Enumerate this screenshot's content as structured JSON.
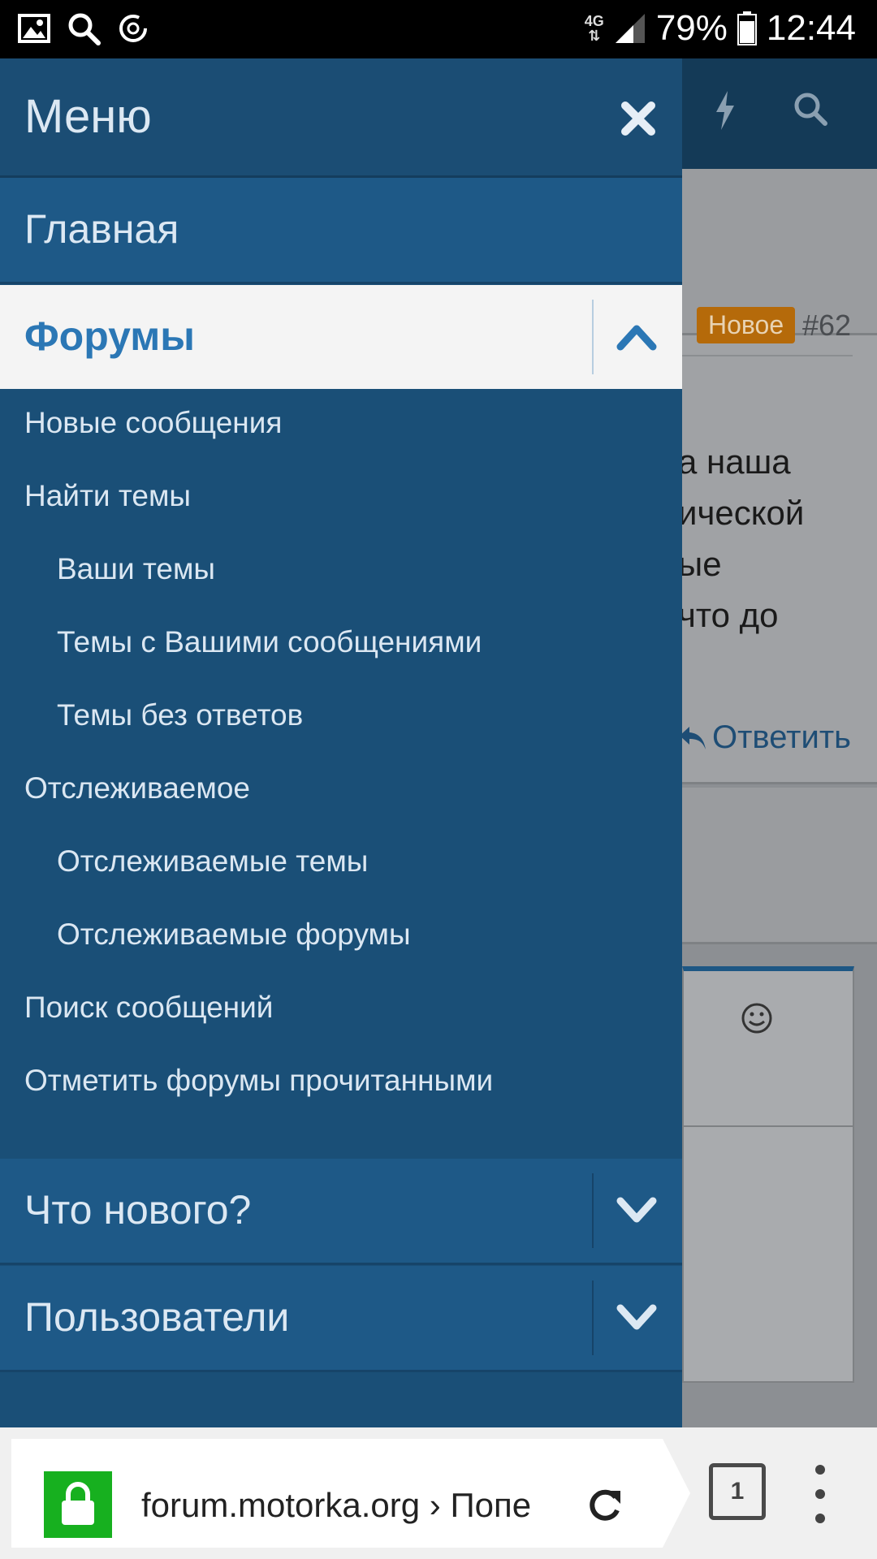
{
  "status_bar": {
    "network": "4G",
    "battery": "79%",
    "time": "12:44",
    "icons": [
      "image-icon",
      "search-icon",
      "sync-icon",
      "signal-icon",
      "battery-icon"
    ]
  },
  "background_page": {
    "badge": "Новое",
    "post_number": "#62",
    "text_lines": [
      "а наша",
      "ической",
      "ые",
      "что до"
    ],
    "reply_label": "Ответить"
  },
  "drawer": {
    "title": "Меню",
    "main_item": "Главная",
    "active_item": "Форумы",
    "forum_sub_items": [
      {
        "label": "Новые сообщения",
        "level": 1
      },
      {
        "label": "Найти темы",
        "level": 1
      },
      {
        "label": "Ваши темы",
        "level": 2
      },
      {
        "label": "Темы с Вашими сообщениями",
        "level": 2
      },
      {
        "label": "Темы без ответов",
        "level": 2
      },
      {
        "label": "Отслеживаемое",
        "level": 1
      },
      {
        "label": "Отслеживаемые темы",
        "level": 2
      },
      {
        "label": "Отслеживаемые форумы",
        "level": 2
      },
      {
        "label": "Поиск сообщений",
        "level": 1
      },
      {
        "label": "Отметить форумы прочитанными",
        "level": 1
      }
    ],
    "collapsed_items": [
      "Что нового?",
      "Пользователи"
    ]
  },
  "browser": {
    "url": "forum.motorka.org › Попе",
    "tab_count": "1"
  },
  "colors": {
    "drawer_bg": "#1a4f77",
    "active_bg": "#f4f4f4",
    "active_text": "#2b77b5",
    "badge": "#b56a0a",
    "lock_green": "#17b01f"
  }
}
